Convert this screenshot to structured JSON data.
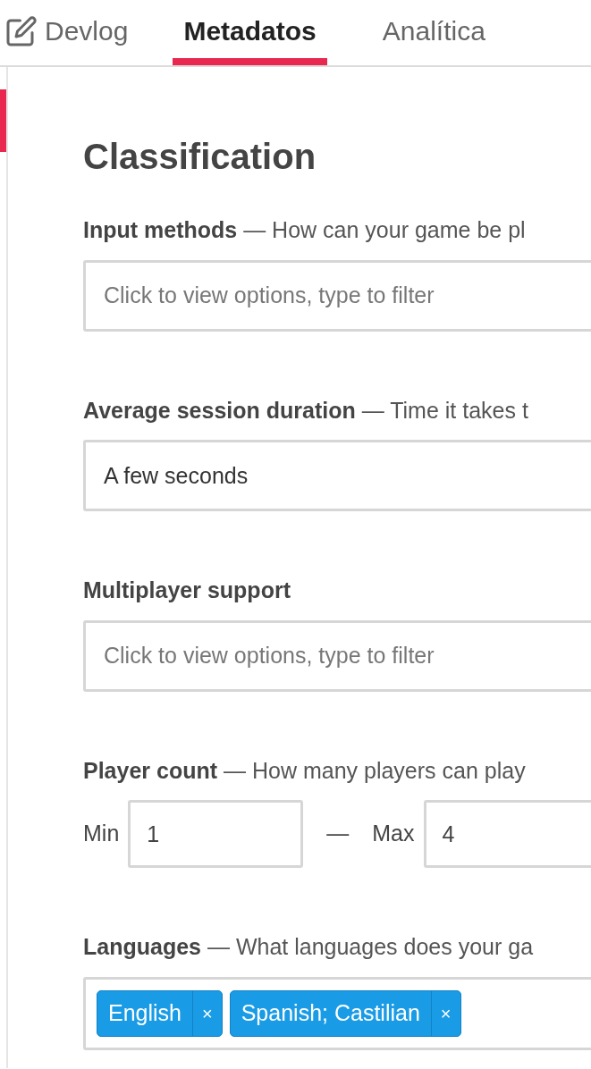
{
  "tabs": [
    {
      "label": "Devlog",
      "selected": false
    },
    {
      "label": "Metadatos",
      "selected": true
    },
    {
      "label": "Analítica",
      "selected": false
    }
  ],
  "section": {
    "title": "Classification"
  },
  "fields": [
    {
      "kind": "select",
      "label": "Input methods",
      "hint": "— How can your game be pl",
      "placeholder": "Click to view options, type to filter"
    },
    {
      "kind": "select",
      "label": "Average session duration",
      "hint": "— Time it takes t",
      "value": "A few seconds"
    },
    {
      "kind": "select",
      "label": "Multiplayer support",
      "placeholder": "Click to view options, type to filter"
    },
    {
      "kind": "range",
      "label": "Player count",
      "hint": "— How many players can play",
      "min_label": "Min",
      "min": "1",
      "separator": "—",
      "max_label": "Max",
      "max": "4"
    },
    {
      "kind": "tags",
      "label": "Languages",
      "hint": "— What languages does your ga",
      "tags": [
        "English",
        "Spanish; Castilian"
      ],
      "remove": "×"
    }
  ]
}
